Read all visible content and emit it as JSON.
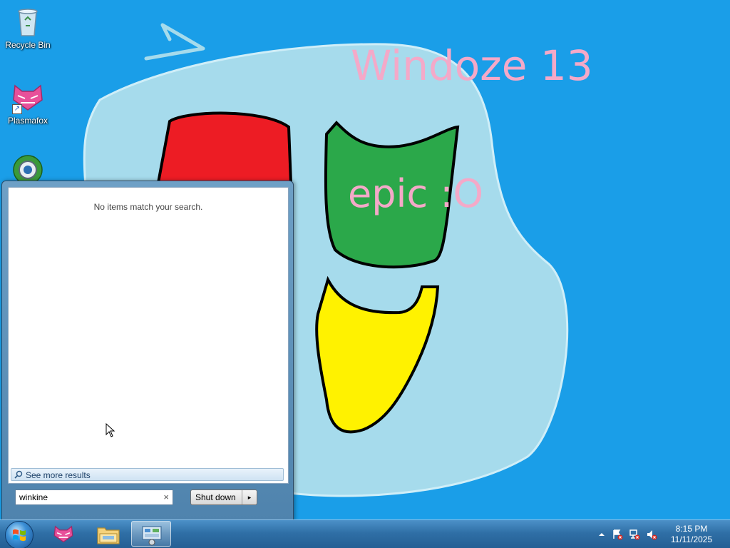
{
  "wallpaper": {
    "title": "Windoze 13",
    "caption": "epic :O"
  },
  "desktop": {
    "icons": [
      {
        "label": "Recycle Bin",
        "icon": "recycle-bin-icon"
      },
      {
        "label": "Plasmafox",
        "icon": "plasmafox-icon"
      },
      {
        "label": "",
        "icon": "browser-globe-icon"
      }
    ]
  },
  "start_menu": {
    "no_results_text": "No items match your search.",
    "see_more_label": "See more results",
    "search_value": "winkine",
    "search_clear": "×",
    "shutdown_label": "Shut down",
    "shutdown_arrow": "▸"
  },
  "taskbar": {
    "pinned": [
      {
        "name": "plasmafox",
        "icon": "plasmafox-icon"
      },
      {
        "name": "file-explorer",
        "icon": "folder-icon"
      },
      {
        "name": "control-panel",
        "icon": "control-panel-icon",
        "active": true
      }
    ],
    "tray": {
      "icons": [
        "show-hidden-icons-arrow",
        "action-center-error-icon",
        "network-error-icon",
        "volume-muted-icon"
      ],
      "time": "8:15 PM",
      "date": "11/11/2025"
    }
  },
  "colors": {
    "desktop_bg": "#1a9ee8",
    "blob": "#a6dbec",
    "red_pane": "#ed1c24",
    "green_pane": "#2ba84a",
    "yellow_pane": "#fff200",
    "title_pink": "#f4a9c8"
  }
}
